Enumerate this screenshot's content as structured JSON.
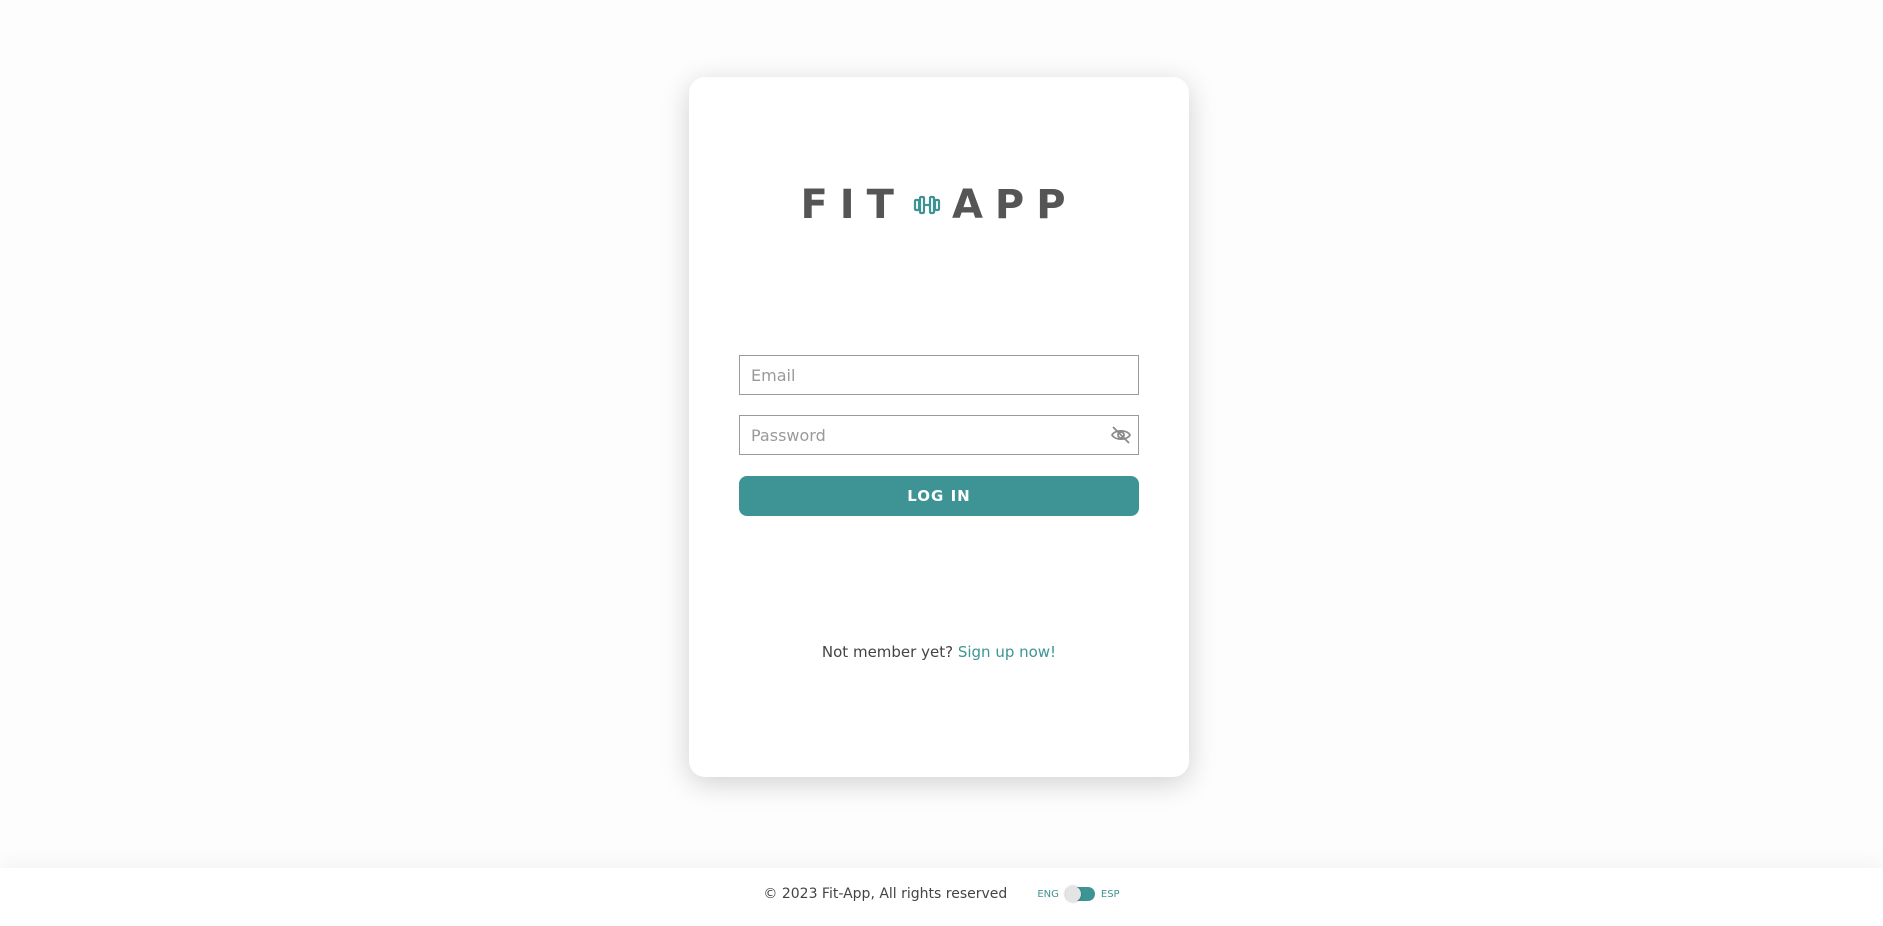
{
  "logo": {
    "word1": "FIT",
    "word2": "APP",
    "icon": "dumbbell-icon",
    "text_color": "#555555",
    "icon_color": "#3e9494"
  },
  "form": {
    "email_placeholder": "Email",
    "email_value": "",
    "password_placeholder": "Password",
    "password_value": "",
    "toggle_visibility_icon": "eye-slash-icon",
    "login_label": "LOG IN"
  },
  "signup": {
    "prompt": "Not member yet?",
    "link_label": "Sign up now!"
  },
  "footer": {
    "copyright": "© 2023 Fit-App, All rights reserved",
    "lang_left": "ENG",
    "lang_right": "ESP"
  },
  "colors": {
    "accent": "#3e9494",
    "text": "#444444",
    "background": "#fdfdfd"
  }
}
